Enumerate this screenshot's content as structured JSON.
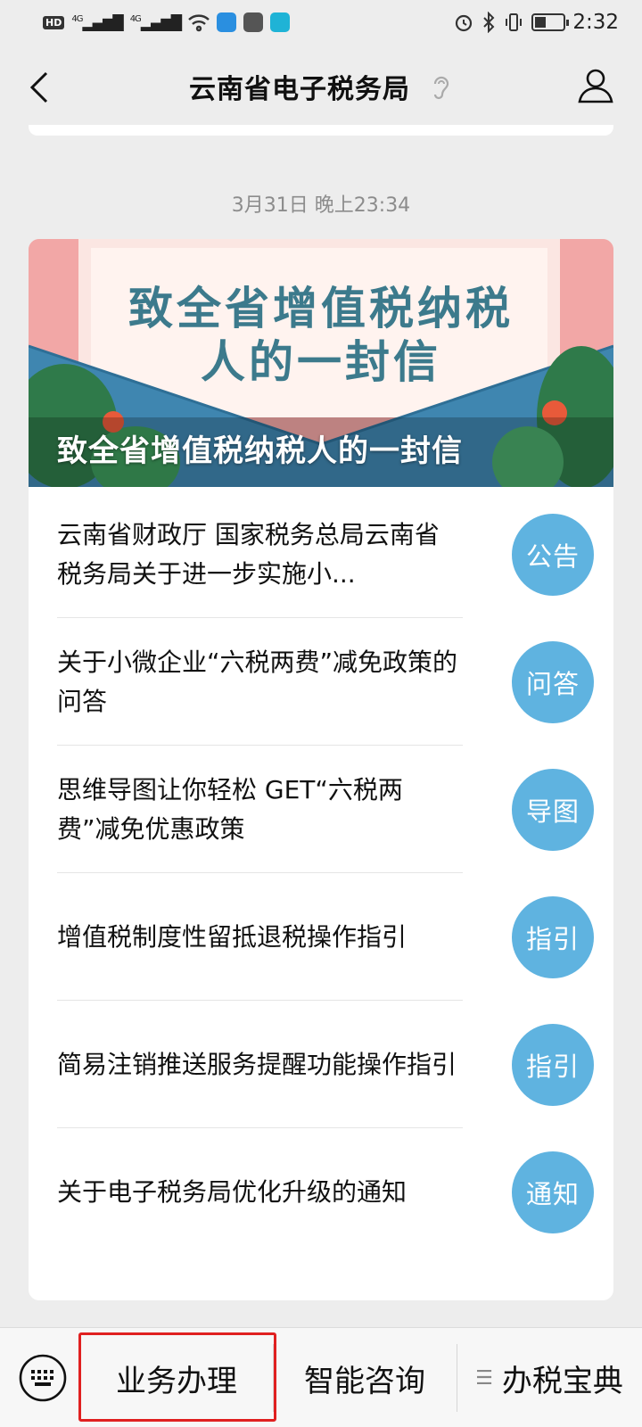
{
  "status_bar": {
    "left_chip": "HD",
    "signal1": "4G",
    "signal2": "4G",
    "time": "2:32"
  },
  "nav": {
    "title": "云南省电子税务局"
  },
  "timestamp": "3月31日 晚上23:34",
  "cover": {
    "art_title_line1": "致全省增值税纳税",
    "art_title_line2": "人的一封信",
    "caption": "致全省增值税纳税人的一封信"
  },
  "articles": [
    {
      "title": "云南省财政厅 国家税务总局云南省税务局关于进一步实施小...",
      "badge": "公告"
    },
    {
      "title": "关于小微企业“六税两费”减免政策的问答",
      "badge": "问答"
    },
    {
      "title": "思维导图让你轻松 GET“六税两费”减免优惠政策",
      "badge": "导图"
    },
    {
      "title": "增值税制度性留抵退税操作指引",
      "badge": "指引"
    },
    {
      "title": "简易注销推送服务提醒功能操作指引",
      "badge": "指引"
    },
    {
      "title": "关于电子税务局优化升级的通知",
      "badge": "通知"
    }
  ],
  "bottom_menu": {
    "items": [
      "业务办理",
      "智能咨询",
      "办税宝典"
    ]
  },
  "colors": {
    "badge": "#5fb3e0",
    "highlight": "#e02020",
    "background": "#ededed"
  }
}
